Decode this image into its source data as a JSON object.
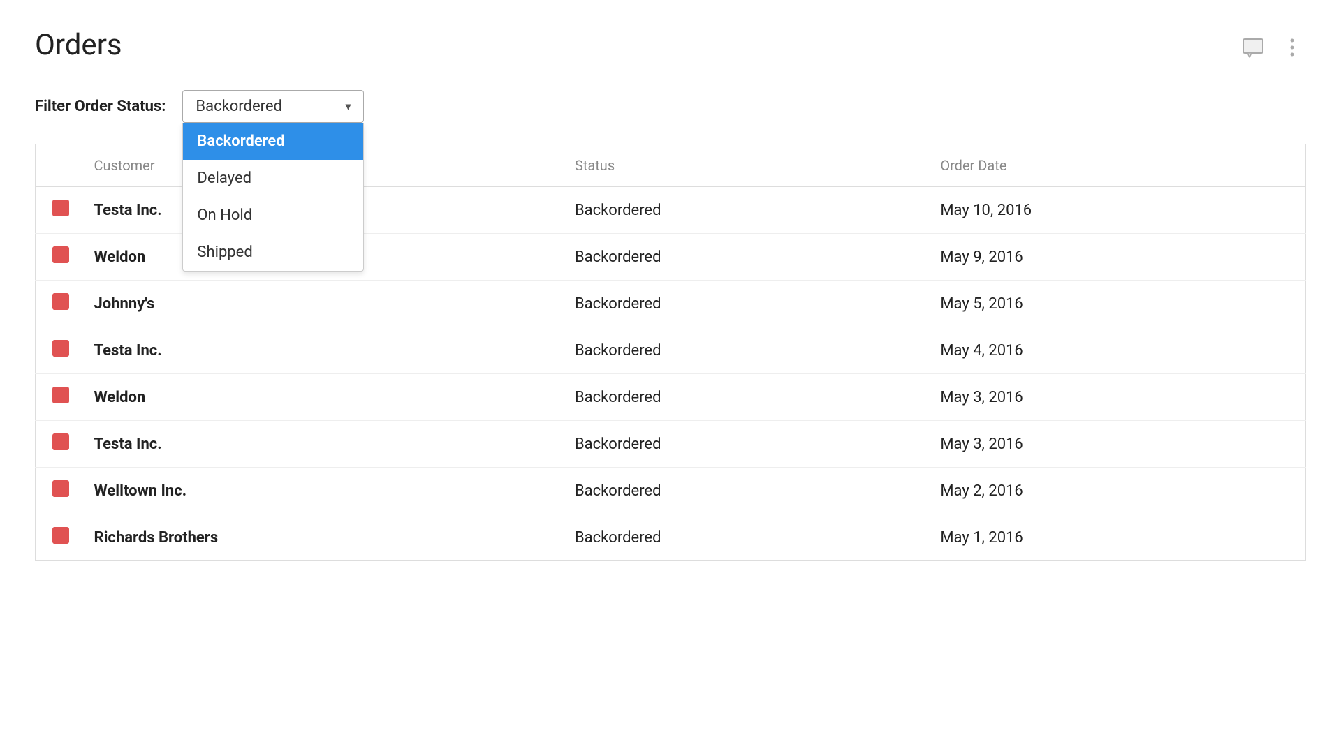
{
  "page": {
    "title": "Orders"
  },
  "filter": {
    "label": "Filter Order Status:",
    "selected_value": "Backordered",
    "options": [
      {
        "value": "Backordered",
        "label": "Backordered",
        "selected": true
      },
      {
        "value": "Delayed",
        "label": "Delayed",
        "selected": false
      },
      {
        "value": "On Hold",
        "label": "On Hold",
        "selected": false
      },
      {
        "value": "Shipped",
        "label": "Shipped",
        "selected": false
      }
    ]
  },
  "table": {
    "columns": [
      {
        "id": "icon",
        "label": ""
      },
      {
        "id": "customer",
        "label": "Customer"
      },
      {
        "id": "status",
        "label": "Status"
      },
      {
        "id": "order_date",
        "label": "Order Date"
      }
    ],
    "rows": [
      {
        "customer": "Testa Inc.",
        "status": "Backordered",
        "order_date": "May 10, 2016"
      },
      {
        "customer": "Weldon",
        "status": "Backordered",
        "order_date": "May 9, 2016"
      },
      {
        "customer": "Johnny's",
        "status": "Backordered",
        "order_date": "May 5, 2016"
      },
      {
        "customer": "Testa Inc.",
        "status": "Backordered",
        "order_date": "May 4, 2016"
      },
      {
        "customer": "Weldon",
        "status": "Backordered",
        "order_date": "May 3, 2016"
      },
      {
        "customer": "Testa Inc.",
        "status": "Backordered",
        "order_date": "May 3, 2016"
      },
      {
        "customer": "Welltown Inc.",
        "status": "Backordered",
        "order_date": "May 2, 2016"
      },
      {
        "customer": "Richards Brothers",
        "status": "Backordered",
        "order_date": "May 1, 2016"
      }
    ]
  },
  "icons": {
    "comment": "💬",
    "more": "⋮"
  }
}
